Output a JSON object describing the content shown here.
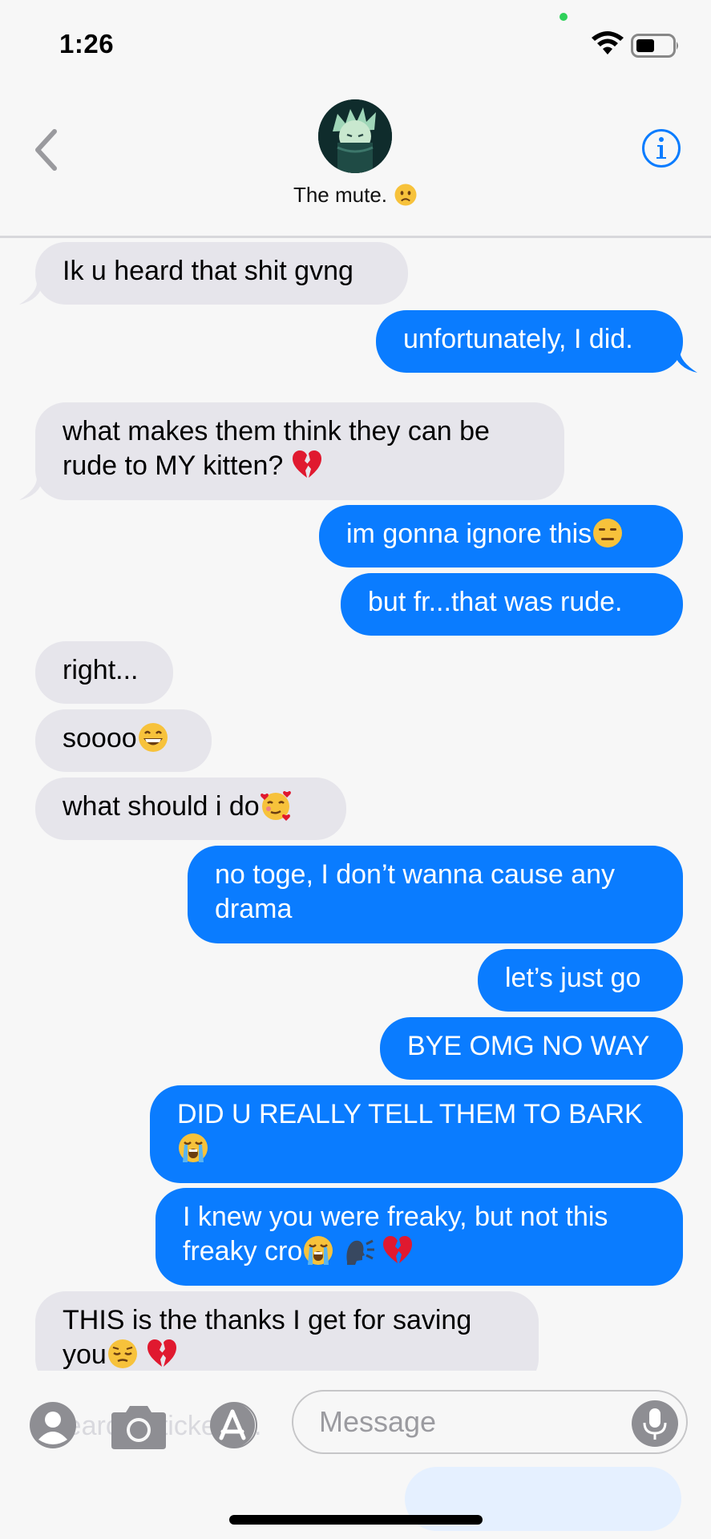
{
  "status_bar": {
    "time": "1:26"
  },
  "header": {
    "contact_name": "The mute."
  },
  "messages": [
    {
      "from": "them",
      "text": "Ik u heard that shit gvng"
    },
    {
      "from": "me",
      "text": "unfortunately, I did."
    },
    {
      "from": "them",
      "line1": "what makes them think they can be",
      "line2": "rude to MY kitten?"
    },
    {
      "from": "me",
      "text": "im gonna ignore this"
    },
    {
      "from": "me",
      "text": "but fr...that was rude."
    },
    {
      "from": "them",
      "text": "right..."
    },
    {
      "from": "them",
      "text": "soooo"
    },
    {
      "from": "them",
      "text": "what should i do"
    },
    {
      "from": "me",
      "line1": "no toge, I don’t wanna cause any",
      "line2": "drama"
    },
    {
      "from": "me",
      "text": "let’s just go"
    },
    {
      "from": "me",
      "text": "BYE OMG NO WAY"
    },
    {
      "from": "me",
      "text": "DID U REALLY TELL THEM TO BARK"
    },
    {
      "from": "me",
      "line1": "I knew you were freaky, but not this",
      "line2": "freaky cro"
    },
    {
      "from": "them",
      "line1": "THIS is the thanks I get for saving",
      "line2": "you"
    }
  ],
  "composer": {
    "placeholder": "Message",
    "ghost_text": "Search Stickers..."
  },
  "colors": {
    "outgoing": "#0a7cff",
    "incoming": "#e6e5eb",
    "accent": "#0a7cff"
  },
  "icons": [
    "back-chevron-icon",
    "info-icon",
    "contact-icon",
    "camera-icon",
    "app-store-icon",
    "microphone-icon",
    "wifi-icon",
    "battery-icon"
  ]
}
